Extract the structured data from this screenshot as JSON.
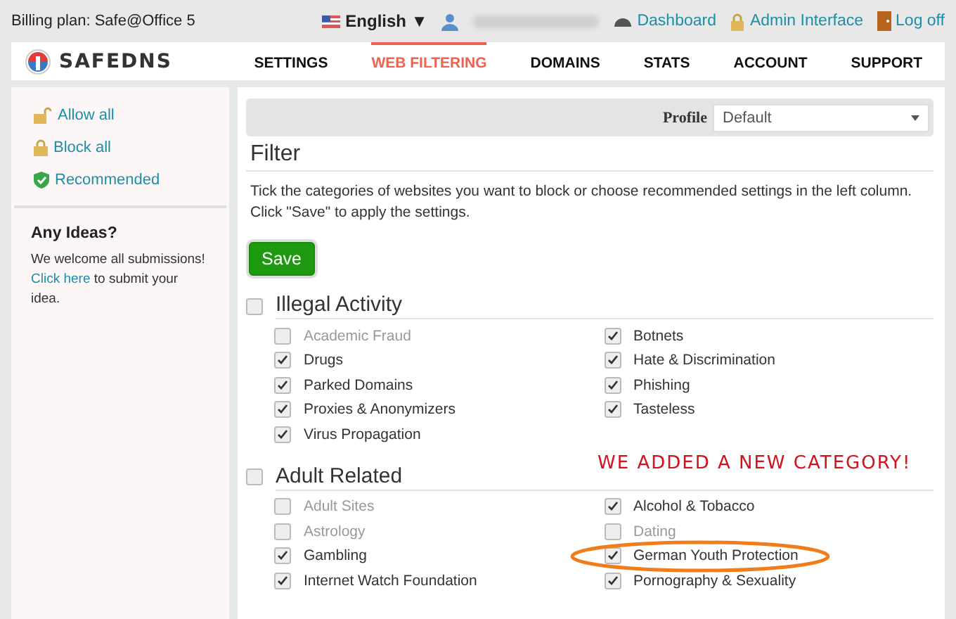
{
  "top_bar": {
    "billing_plan": "Billing plan: Safe@Office 5",
    "language": "English ▼",
    "links": [
      {
        "kind": "dashboard",
        "label": "Dashboard"
      },
      {
        "kind": "admin",
        "label": "Admin Interface"
      },
      {
        "kind": "logoff",
        "label": "Log off"
      }
    ]
  },
  "nav": {
    "logo": "SAFEDNS",
    "items": [
      {
        "label": "SETTINGS",
        "selected": false
      },
      {
        "label": "WEB FILTERING",
        "selected": true
      },
      {
        "label": "DOMAINS",
        "selected": false
      },
      {
        "label": "STATS",
        "selected": false
      },
      {
        "label": "ACCOUNT",
        "selected": false
      },
      {
        "label": "SUPPORT",
        "selected": false
      }
    ]
  },
  "sidebar": {
    "actions": [
      {
        "kind": "allow",
        "label": "Allow all"
      },
      {
        "kind": "block",
        "label": "Block all"
      },
      {
        "kind": "recommended",
        "label": "Recommended"
      }
    ],
    "ideas_title": "Any Ideas?",
    "ideas_text": "We welcome all submissions!",
    "ideas_link": "Click here",
    "ideas_rest": " to submit your idea."
  },
  "profile": {
    "label": "Profile",
    "value": "Default"
  },
  "filter": {
    "title": "Filter",
    "description": "Tick the categories of websites you want to block or choose recommended settings in the left column. Click \"Save\" to apply the settings.",
    "save": "Save"
  },
  "categories": [
    {
      "name": "Illegal Activity",
      "checked": false,
      "items": [
        {
          "label": "Academic Fraud",
          "checked": false,
          "highlighted": false
        },
        {
          "label": "Drugs",
          "checked": true,
          "highlighted": false
        },
        {
          "label": "Parked Domains",
          "checked": true,
          "highlighted": false
        },
        {
          "label": "Proxies & Anonymizers",
          "checked": true,
          "highlighted": false
        },
        {
          "label": "Virus Propagation",
          "checked": true,
          "highlighted": false
        },
        {
          "label": "Botnets",
          "checked": true,
          "highlighted": false
        },
        {
          "label": "Hate & Discrimination",
          "checked": true,
          "highlighted": false
        },
        {
          "label": "Phishing",
          "checked": true,
          "highlighted": false
        },
        {
          "label": "Tasteless",
          "checked": true,
          "highlighted": false
        }
      ]
    },
    {
      "name": "Adult Related",
      "checked": false,
      "annotation": "WE ADDED A NEW CATEGORY!",
      "items": [
        {
          "label": "Adult Sites",
          "checked": false,
          "highlighted": false
        },
        {
          "label": "Astrology",
          "checked": false,
          "highlighted": false
        },
        {
          "label": "Gambling",
          "checked": true,
          "highlighted": false
        },
        {
          "label": "Internet Watch Foundation",
          "checked": true,
          "highlighted": false
        },
        {
          "label": "Alcohol & Tobacco",
          "checked": true,
          "highlighted": false
        },
        {
          "label": "Dating",
          "checked": false,
          "highlighted": false
        },
        {
          "label": "German Youth Protection",
          "checked": true,
          "highlighted": true
        },
        {
          "label": "Pornography & Sexuality",
          "checked": true,
          "highlighted": false
        }
      ]
    }
  ]
}
